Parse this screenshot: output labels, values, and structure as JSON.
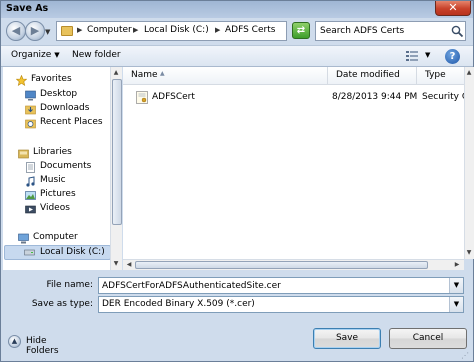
{
  "window": {
    "title": "Save As",
    "close_symbol": "✕"
  },
  "address_bar": {
    "segments": [
      "Computer",
      "Local Disk (C:)",
      "ADFS Certs"
    ]
  },
  "search": {
    "value": "Search ADFS Certs"
  },
  "toolbar": {
    "organize_label": "Organize",
    "new_folder_label": "New folder"
  },
  "nav": {
    "favorites": {
      "label": "Favorites",
      "items": [
        "Desktop",
        "Downloads",
        "Recent Places"
      ]
    },
    "libraries": {
      "label": "Libraries",
      "items": [
        "Documents",
        "Music",
        "Pictures",
        "Videos"
      ]
    },
    "computer": {
      "label": "Computer",
      "items": [
        "Local Disk (C:)"
      ]
    }
  },
  "list": {
    "columns": [
      "Name",
      "Date modified",
      "Type"
    ],
    "rows": [
      {
        "name": "ADFSCert",
        "date_modified": "8/28/2013 9:44 PM",
        "type": "Security Cert"
      }
    ]
  },
  "form": {
    "file_name_label": "File name:",
    "file_name_value": "ADFSCertForADFSAuthenticatedSite.cer",
    "save_type_label": "Save as type:",
    "save_type_value": "DER Encoded Binary X.509 (*.cer)"
  },
  "footer": {
    "hide_folders_label": "Hide Folders",
    "save_label": "Save",
    "cancel_label": "Cancel"
  },
  "colors": {
    "selection": "#c7d9ef",
    "chrome": "#cfdcec",
    "close": "#c8412a"
  }
}
